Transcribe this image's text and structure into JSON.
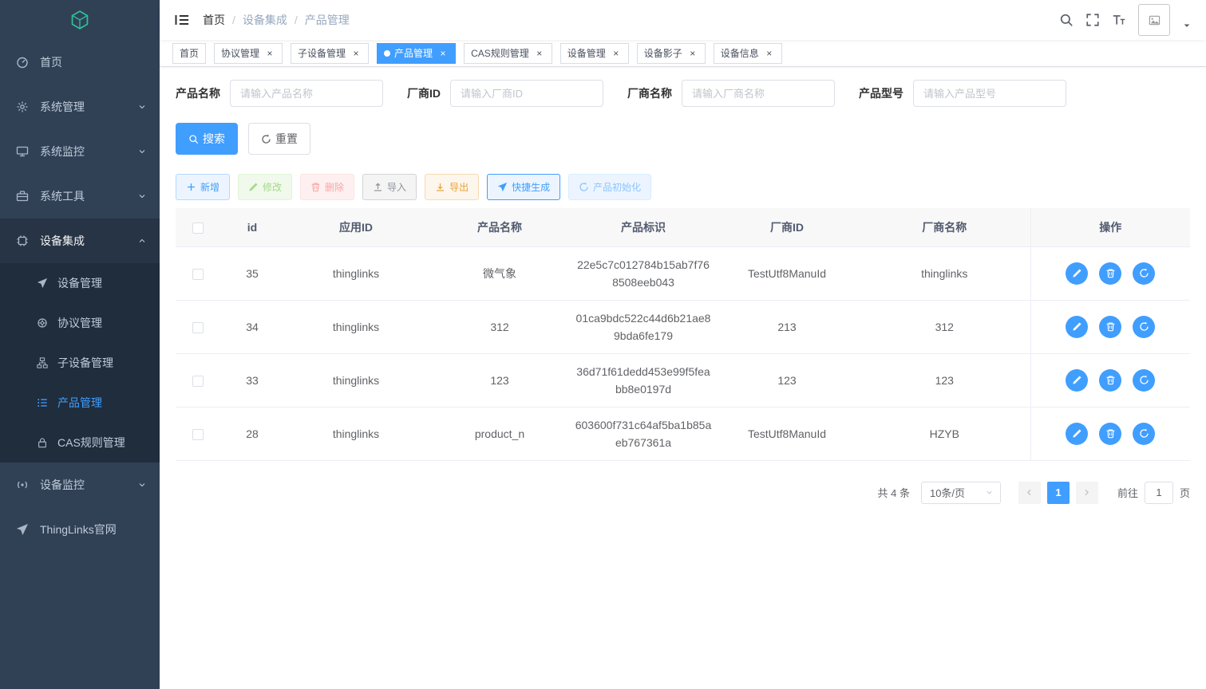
{
  "colors": {
    "accent": "#409eff",
    "sidebar_bg": "#304156",
    "submenu_bg": "#1f2d3d",
    "logo_teal": "#2fbf9a",
    "warning": "#e6a23c",
    "danger_plain_text": "#f9a7a7",
    "success_plain_text": "#a4da89",
    "table_header_bg": "#f8f8f9"
  },
  "ui": {
    "slash": "/",
    "close_glyph": "×"
  },
  "sidebar": {
    "logo_icon": "thinglinks-logo-icon",
    "items": [
      {
        "label": "首页",
        "icon": "dashboard-icon"
      },
      {
        "label": "系统管理",
        "icon": "gear-icon",
        "chevron": "down"
      },
      {
        "label": "系统监控",
        "icon": "monitor-icon",
        "chevron": "down"
      },
      {
        "label": "系统工具",
        "icon": "toolbox-icon",
        "chevron": "down"
      },
      {
        "label": "设备集成",
        "icon": "chip-icon",
        "chevron": "up",
        "expanded": true
      },
      {
        "label": "设备监控",
        "icon": "signal-icon",
        "chevron": "down"
      },
      {
        "label": "ThingLinks官网",
        "icon": "paper-plane-icon"
      }
    ],
    "submenu": [
      {
        "label": "设备管理",
        "icon": "paper-plane-icon"
      },
      {
        "label": "协议管理",
        "icon": "wheel-icon"
      },
      {
        "label": "子设备管理",
        "icon": "tree-icon"
      },
      {
        "label": "产品管理",
        "icon": "list-icon",
        "active": true
      },
      {
        "label": "CAS规则管理",
        "icon": "lock-icon"
      }
    ]
  },
  "navbar": {
    "breadcrumb": [
      "首页",
      "设备集成",
      "产品管理"
    ],
    "right_icons": [
      "search-icon",
      "fullscreen-icon",
      "font-size-icon",
      "avatar",
      "caret-down-icon"
    ]
  },
  "tabs": [
    {
      "label": "首页",
      "closable": false,
      "active": false
    },
    {
      "label": "协议管理",
      "closable": true,
      "active": false
    },
    {
      "label": "子设备管理",
      "closable": true,
      "active": false
    },
    {
      "label": "产品管理",
      "closable": true,
      "active": true
    },
    {
      "label": "CAS规则管理",
      "closable": true,
      "active": false
    },
    {
      "label": "设备管理",
      "closable": true,
      "active": false
    },
    {
      "label": "设备影子",
      "closable": true,
      "active": false
    },
    {
      "label": "设备信息",
      "closable": true,
      "active": false
    }
  ],
  "filters": [
    {
      "label": "产品名称",
      "placeholder": "请输入产品名称"
    },
    {
      "label": "厂商ID",
      "placeholder": "请输入厂商ID"
    },
    {
      "label": "厂商名称",
      "placeholder": "请输入厂商名称"
    },
    {
      "label": "产品型号",
      "placeholder": "请输入产品型号"
    }
  ],
  "search": {
    "search_label": "搜索",
    "reset_label": "重置"
  },
  "toolbar": {
    "buttons": [
      {
        "label": "新增",
        "icon": "plus-icon",
        "type": "primary-plain",
        "disabled": false
      },
      {
        "label": "修改",
        "icon": "pencil-icon",
        "type": "success-plain",
        "disabled": true
      },
      {
        "label": "删除",
        "icon": "trash-icon",
        "type": "danger-plain",
        "disabled": true
      },
      {
        "label": "导入",
        "icon": "upload-icon",
        "type": "info-plain",
        "disabled": false
      },
      {
        "label": "导出",
        "icon": "download-icon",
        "type": "warning-plain",
        "disabled": false
      },
      {
        "label": "快捷生成",
        "icon": "paper-plane-icon",
        "type": "primary-outline",
        "disabled": false
      },
      {
        "label": "产品初始化",
        "icon": "refresh-icon",
        "type": "primary-plain",
        "disabled": true
      }
    ]
  },
  "table": {
    "columns": [
      "id",
      "应用ID",
      "产品名称",
      "产品标识",
      "厂商ID",
      "厂商名称",
      "操作"
    ],
    "row_actions": [
      {
        "name": "edit-button",
        "icon": "pencil-icon"
      },
      {
        "name": "delete-button",
        "icon": "trash-icon"
      },
      {
        "name": "refresh-button",
        "icon": "refresh-icon"
      }
    ],
    "rows": [
      {
        "id": "35",
        "app_id": "thinglinks",
        "name": "微气象",
        "identifier": "22e5c7c012784b15ab7f768508eeb043",
        "manu_id": "TestUtf8ManuId",
        "manu_name": "thinglinks"
      },
      {
        "id": "34",
        "app_id": "thinglinks",
        "name": "312",
        "identifier": "01ca9bdc522c44d6b21ae89bda6fe179",
        "manu_id": "213",
        "manu_name": "312"
      },
      {
        "id": "33",
        "app_id": "thinglinks",
        "name": "123",
        "identifier": "36d71f61dedd453e99f5feabb8e0197d",
        "manu_id": "123",
        "manu_name": "123"
      },
      {
        "id": "28",
        "app_id": "thinglinks",
        "name": "product_n",
        "identifier": "603600f731c64af5ba1b85aeb767361a",
        "manu_id": "TestUtf8ManuId",
        "manu_name": "HZYB"
      }
    ]
  },
  "pagination": {
    "total": "共 4 条",
    "page_size": "10条/页",
    "current_page": "1",
    "goto_label": "前往",
    "goto_value": "1",
    "page_label": "页"
  }
}
